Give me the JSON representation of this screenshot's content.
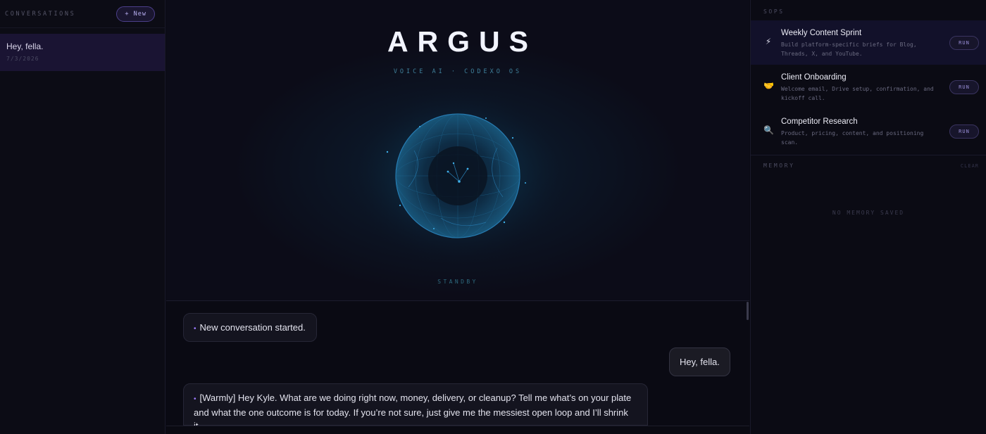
{
  "sidebar": {
    "title": "CONVERSATIONS",
    "new_button": "+ New",
    "conversations": [
      {
        "title": "Hey, fella.",
        "date": "7/3/2026"
      }
    ]
  },
  "hero": {
    "brand": "ARGUS",
    "tagline": "VOICE AI · CODEXO OS",
    "status": "STANDBY"
  },
  "chat": {
    "messages": [
      {
        "role": "system",
        "text": "New conversation started."
      },
      {
        "role": "user",
        "text": "Hey, fella."
      },
      {
        "role": "assistant",
        "text": "[Warmly] Hey Kyle. What are we doing right now, money, delivery, or cleanup? Tell me what’s on your plate and what the one outcome is for today. If you’re not sure, just give me the messiest open loop and I’ll shrink it."
      }
    ]
  },
  "sops": {
    "title": "SOPS",
    "items": [
      {
        "icon": "⚡",
        "icon_name": "lightning-icon",
        "title": "Weekly Content Sprint",
        "desc": "Build platform-specific briefs for Blog, Threads, X, and YouTube.",
        "run": "RUN"
      },
      {
        "icon": "🤝",
        "icon_name": "handshake-icon",
        "title": "Client Onboarding",
        "desc": "Welcome email, Drive setup, confirmation, and kickoff call.",
        "run": "RUN"
      },
      {
        "icon": "🔍",
        "icon_name": "magnifier-icon",
        "title": "Competitor Research",
        "desc": "Product, pricing, content, and positioning scan.",
        "run": "RUN"
      }
    ]
  },
  "memory": {
    "title": "MEMORY",
    "clear": "CLEAR",
    "empty": "NO MEMORY SAVED"
  },
  "colors": {
    "accent": "#9d7bff",
    "orb": "#1f7fb8",
    "background": "#0a0a14"
  }
}
